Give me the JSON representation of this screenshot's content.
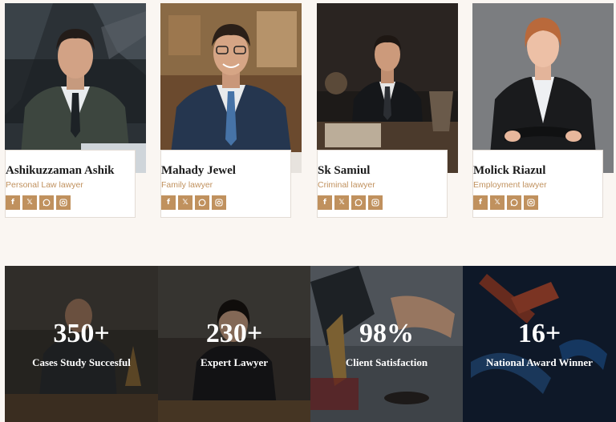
{
  "team": {
    "members": [
      {
        "name": "Ashikuzzaman Ashik",
        "role": "Personal Law lawyer"
      },
      {
        "name": "Mahady Jewel",
        "role": "Family lawyer"
      },
      {
        "name": "Sk Samiul",
        "role": "Criminal lawyer"
      },
      {
        "name": "Molick Riazul",
        "role": "Employment lawyer"
      }
    ],
    "social_icons": [
      "facebook-icon",
      "x-icon",
      "whatsapp-icon",
      "instagram-icon"
    ],
    "social_labels": {
      "facebook": "f",
      "x": "𝕏"
    }
  },
  "stats": [
    {
      "value": "350+",
      "label": "Cases Study Succesful"
    },
    {
      "value": "230+",
      "label": "Expert Lawyer"
    },
    {
      "value": "98%",
      "label": "Client Satisfaction"
    },
    {
      "value": "16+",
      "label": "National Award Winner"
    }
  ],
  "colors": {
    "accent": "#c0915e",
    "background": "#faf6f2",
    "text": "#1b1b1b"
  }
}
